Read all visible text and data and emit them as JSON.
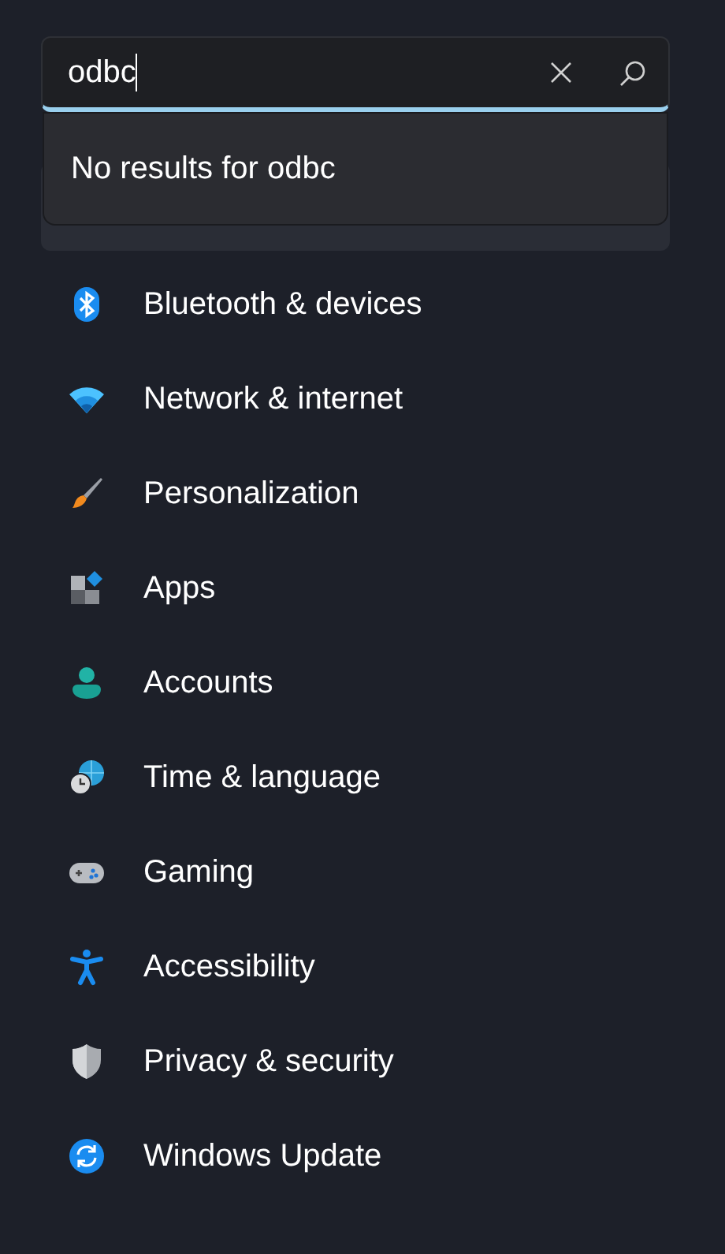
{
  "search": {
    "value": "odbc"
  },
  "suggestion": {
    "text": "No results for odbc"
  },
  "nav_items": [
    {
      "kind": "bluetooth",
      "label": "Bluetooth & devices"
    },
    {
      "kind": "network",
      "label": "Network & internet"
    },
    {
      "kind": "personalization",
      "label": "Personalization"
    },
    {
      "kind": "apps",
      "label": "Apps"
    },
    {
      "kind": "accounts",
      "label": "Accounts"
    },
    {
      "kind": "time",
      "label": "Time & language"
    },
    {
      "kind": "gaming",
      "label": "Gaming"
    },
    {
      "kind": "accessibility",
      "label": "Accessibility"
    },
    {
      "kind": "privacy",
      "label": "Privacy & security"
    },
    {
      "kind": "update",
      "label": "Windows Update"
    }
  ]
}
